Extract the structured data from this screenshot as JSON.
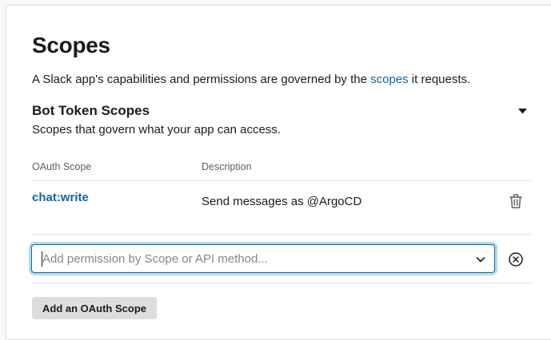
{
  "page": {
    "title": "Scopes",
    "intro_before": "A Slack app's capabilities and permissions are governed by the ",
    "intro_link": "scopes",
    "intro_after": " it requests."
  },
  "bot_token_scopes": {
    "title": "Bot Token Scopes",
    "subtitle": "Scopes that govern what your app can access.",
    "columns": {
      "scope": "OAuth Scope",
      "description": "Description"
    },
    "rows": [
      {
        "scope": "chat:write",
        "description": "Send messages as @ArgoCD"
      }
    ],
    "add_input": {
      "placeholder": "Add permission by Scope or API method...",
      "value": ""
    },
    "add_button_label": "Add an OAuth Scope",
    "expanded": true
  },
  "icons": {
    "collapse": "caret-down-icon",
    "delete": "trash-icon",
    "dropdown": "chevron-down-icon",
    "clear": "circle-x-icon"
  },
  "colors": {
    "link": "#1264a3",
    "focus_ring": "#1d9bd1",
    "text": "#1d1c1d",
    "muted": "#616061",
    "button_bg": "#dddddd"
  }
}
